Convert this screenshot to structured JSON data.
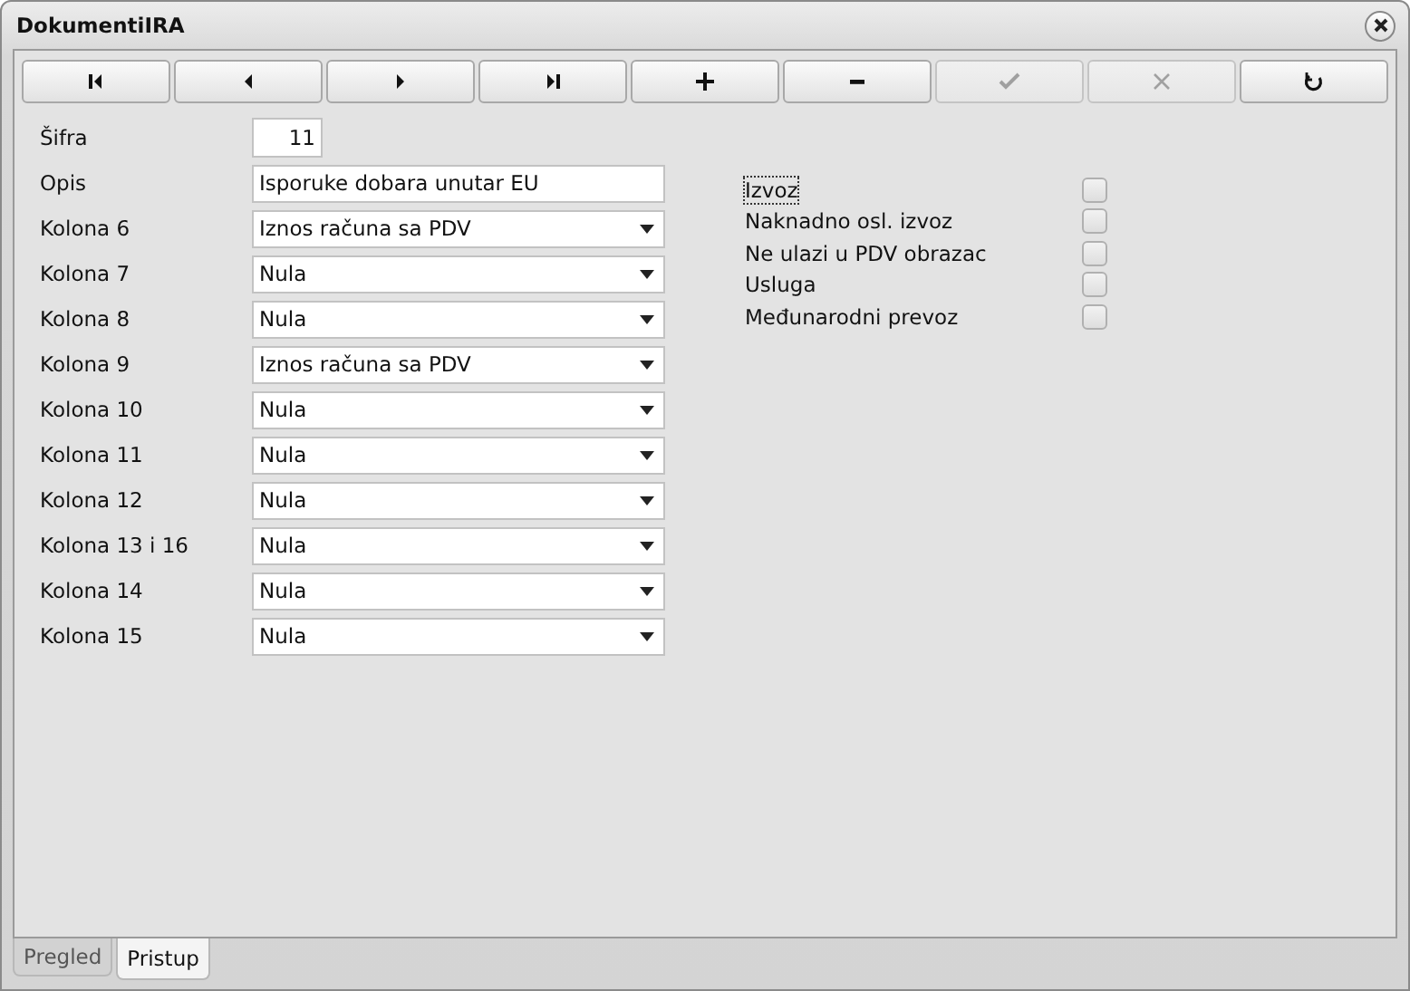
{
  "window": {
    "title": "DokumentiIRA"
  },
  "toolbar": [
    {
      "kind": "first",
      "disabled": false
    },
    {
      "kind": "prev",
      "disabled": false
    },
    {
      "kind": "next",
      "disabled": false
    },
    {
      "kind": "last",
      "disabled": false
    },
    {
      "kind": "add",
      "disabled": false
    },
    {
      "kind": "remove",
      "disabled": false
    },
    {
      "kind": "confirm",
      "disabled": true
    },
    {
      "kind": "cancel",
      "disabled": true
    },
    {
      "kind": "refresh",
      "disabled": false
    }
  ],
  "fields": [
    {
      "kind": "number",
      "label": "Šifra",
      "value": "11"
    },
    {
      "kind": "text",
      "label": "Opis",
      "value": "Isporuke dobara unutar EU"
    },
    {
      "kind": "select",
      "label": "Kolona 6",
      "value": "Iznos računa sa PDV"
    },
    {
      "kind": "select",
      "label": "Kolona 7",
      "value": "Nula"
    },
    {
      "kind": "select",
      "label": "Kolona 8",
      "value": "Nula"
    },
    {
      "kind": "select",
      "label": "Kolona 9",
      "value": "Iznos računa sa PDV"
    },
    {
      "kind": "select",
      "label": "Kolona 10",
      "value": "Nula"
    },
    {
      "kind": "select",
      "label": "Kolona 11",
      "value": "Nula"
    },
    {
      "kind": "select",
      "label": "Kolona 12",
      "value": "Nula"
    },
    {
      "kind": "select",
      "label": "Kolona 13 i 16",
      "value": "Nula"
    },
    {
      "kind": "select",
      "label": "Kolona 14",
      "value": "Nula"
    },
    {
      "kind": "select",
      "label": "Kolona 15",
      "value": "Nula"
    }
  ],
  "checkboxes": [
    {
      "label": "Izvoz",
      "checked": false,
      "focused": true
    },
    {
      "label": "Naknadno osl. izvoz",
      "checked": false,
      "focused": false
    },
    {
      "label": "Ne ulazi u PDV obrazac",
      "checked": false,
      "focused": false
    },
    {
      "label": "Usluga",
      "checked": false,
      "focused": false
    },
    {
      "label": "Međunarodni prevoz",
      "checked": false,
      "focused": false
    }
  ],
  "tabs": [
    {
      "label": "Pregled",
      "selected": false
    },
    {
      "label": "Pristup",
      "selected": true
    }
  ]
}
